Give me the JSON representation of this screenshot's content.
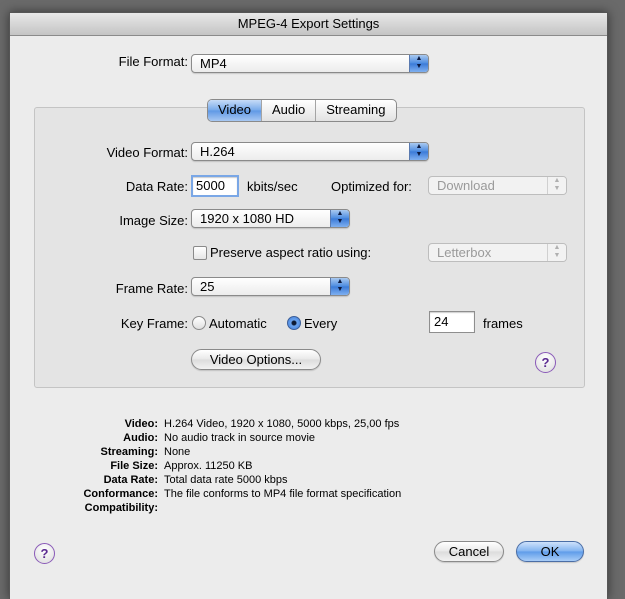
{
  "window": {
    "title": "MPEG-4 Export Settings"
  },
  "file_format": {
    "label": "File Format:",
    "value": "MP4"
  },
  "tabs": [
    {
      "label": "Video",
      "active": true
    },
    {
      "label": "Audio",
      "active": false
    },
    {
      "label": "Streaming",
      "active": false
    }
  ],
  "video": {
    "format": {
      "label": "Video Format:",
      "value": "H.264"
    },
    "data_rate": {
      "label": "Data Rate:",
      "value": "5000",
      "unit": "kbits/sec"
    },
    "optimized_for": {
      "label": "Optimized for:",
      "value": "Download"
    },
    "image_size": {
      "label": "Image Size:",
      "value": "1920 x 1080 HD"
    },
    "preserve_aspect": {
      "label": "Preserve aspect ratio using:",
      "checked": false
    },
    "letterbox": {
      "value": "Letterbox"
    },
    "frame_rate": {
      "label": "Frame Rate:",
      "value": "25"
    },
    "key_frame": {
      "label": "Key Frame:",
      "automatic_label": "Automatic",
      "every_label": "Every",
      "selected": "Every",
      "frames_value": "24",
      "frames_unit": "frames"
    },
    "options_button": "Video Options..."
  },
  "help_label": "?",
  "summary": [
    {
      "key": "Video:",
      "value": "H.264 Video, 1920 x 1080, 5000 kbps, 25,00 fps"
    },
    {
      "key": "Audio:",
      "value": "No audio track in source movie"
    },
    {
      "key": "Streaming:",
      "value": "None"
    },
    {
      "key": "File Size:",
      "value": "Approx. 11250 KB"
    },
    {
      "key": "Data Rate:",
      "value": "Total data rate 5000 kbps"
    },
    {
      "key": "Conformance:",
      "value": "The file conforms to MP4 file format specification"
    },
    {
      "key": "Compatibility:",
      "value": ""
    }
  ],
  "buttons": {
    "cancel": "Cancel",
    "ok": "OK"
  },
  "colors": {
    "accent": "#5d9be9",
    "help_purple": "#5b2a90"
  }
}
